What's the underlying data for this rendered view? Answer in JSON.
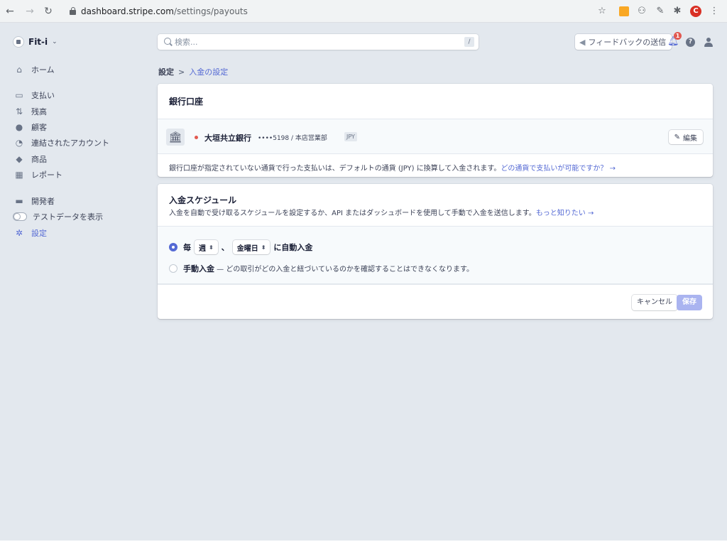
{
  "browser": {
    "url_domain": "dashboard.stripe.com",
    "url_path": "/settings/payouts",
    "profile_initial": "C"
  },
  "account": {
    "name": "Fit-i"
  },
  "sidebar": {
    "items": [
      {
        "label": "ホーム",
        "icon": "home-icon"
      },
      {
        "label": "支払い",
        "icon": "payments-icon"
      },
      {
        "label": "残高",
        "icon": "balance-icon"
      },
      {
        "label": "顧客",
        "icon": "customer-icon"
      },
      {
        "label": "連結されたアカウント",
        "icon": "connected-accounts-icon"
      },
      {
        "label": "商品",
        "icon": "product-icon"
      },
      {
        "label": "レポート",
        "icon": "report-icon"
      },
      {
        "label": "開発者",
        "icon": "developer-icon"
      },
      {
        "label": "テストデータを表示",
        "icon": "toggle"
      },
      {
        "label": "設定",
        "icon": "gear-icon"
      }
    ]
  },
  "header": {
    "search_placeholder": "検索...",
    "search_shortcut": "/",
    "feedback_label": "フィードバックの送信",
    "notification_count": "1"
  },
  "breadcrumb": {
    "root": "設定",
    "separator": ">",
    "current": "入金の設定"
  },
  "bank_card": {
    "title": "銀行口座",
    "bank_name": "大垣共立銀行",
    "account_mask": "••••5198 / 本店営業部",
    "currency": "JPY",
    "edit_label": "編集",
    "note": "銀行口座が指定されていない通貨で行った支払いは、デフォルトの通貨 (JPY) に換算して入金されます。",
    "note_link": "どの通貨で支払いが可能ですか？ →"
  },
  "schedule_card": {
    "title": "入金スケジュール",
    "description": "入金を自動で受け取るスケジュールを設定するか、API またはダッシュボードを使用して手動で入金を送信します。",
    "description_link": "もっと知りたい →",
    "auto_prefix": "毎",
    "interval_value": "週",
    "separator": "、",
    "day_value": "金曜日",
    "auto_suffix": "に自動入金",
    "manual_label": "手動入金",
    "manual_desc": " — どの取引がどの入金と紐づいているのかを確認することはできなくなります。",
    "cancel_label": "キャンセル",
    "save_label": "保存"
  },
  "colors": {
    "accent": "#5469d4",
    "background": "#e3e8ee",
    "danger": "#e25950"
  }
}
